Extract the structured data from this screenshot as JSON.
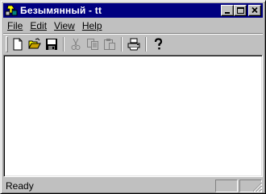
{
  "window": {
    "title": "Безымянный - tt"
  },
  "caption_buttons": {
    "minimize_icon": "minimize-icon",
    "maximize_icon": "maximize-icon",
    "close_icon": "close-icon"
  },
  "menu": {
    "items": [
      {
        "label": "File"
      },
      {
        "label": "Edit"
      },
      {
        "label": "View"
      },
      {
        "label": "Help"
      }
    ]
  },
  "toolbar": {
    "buttons": [
      {
        "icon": "new-document-icon",
        "enabled": true
      },
      {
        "icon": "open-folder-icon",
        "enabled": true
      },
      {
        "icon": "save-icon",
        "enabled": true
      },
      {
        "icon": "cut-icon",
        "enabled": false
      },
      {
        "icon": "copy-icon",
        "enabled": false
      },
      {
        "icon": "paste-icon",
        "enabled": false
      },
      {
        "icon": "print-icon",
        "enabled": true
      },
      {
        "icon": "help-icon",
        "enabled": true
      }
    ]
  },
  "status": {
    "text": "Ready"
  },
  "colors": {
    "titlebar": "#000080",
    "face": "#c0c0c0",
    "client": "#ffffff"
  }
}
